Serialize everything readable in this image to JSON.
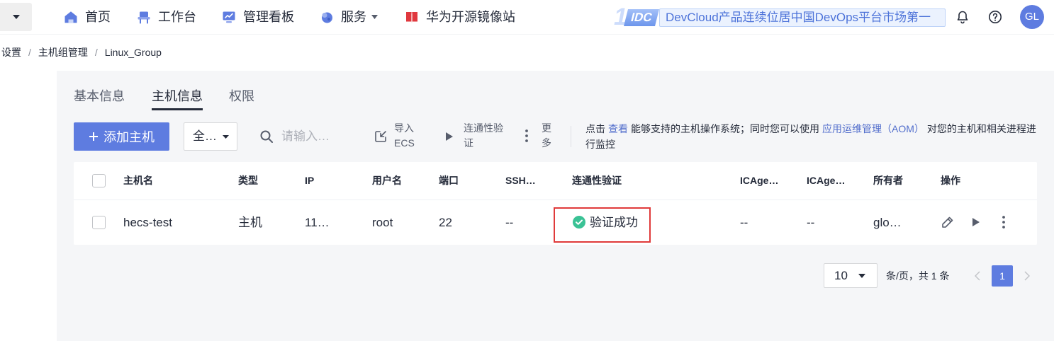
{
  "nav": {
    "items": [
      {
        "label": "首页",
        "icon": "home-icon"
      },
      {
        "label": "工作台",
        "icon": "workbench-icon"
      },
      {
        "label": "管理看板",
        "icon": "dashboard-icon"
      },
      {
        "label": "服务",
        "icon": "service-icon"
      },
      {
        "label": "华为开源镜像站",
        "icon": "mirror-site-icon"
      }
    ],
    "banner": {
      "rank": "1",
      "brand": "IDC",
      "text": "DevCloud产品连续位居中国DevOps平台市场第一"
    },
    "right_icons": [
      "bell-icon",
      "help-icon"
    ],
    "avatar_initials": "GL"
  },
  "breadcrumb": {
    "separator": "/",
    "items": [
      "设置",
      "主机组管理",
      "Linux_Group"
    ]
  },
  "tabs": [
    {
      "label": "基本信息",
      "active": false
    },
    {
      "label": "主机信息",
      "active": true
    },
    {
      "label": "权限",
      "active": false
    }
  ],
  "toolbar": {
    "add_label": "添加主机",
    "filter_value": "全…",
    "search_placeholder": "请输入…",
    "import": {
      "line1": "导入",
      "line2": "ECS",
      "icon": "import-icon"
    },
    "verify": {
      "line1": "连通性验",
      "line2": "证",
      "icon": "play-icon"
    },
    "more": {
      "line1": "更",
      "line2": "多",
      "icon": "more-vertical-icon"
    },
    "hint": {
      "prefix": "点击",
      "link_view": "查看",
      "middle": "能够支持的主机操作系统；同时您可以使用",
      "link_aom": "应用运维管理（AOM）",
      "suffix": "对您的主机和相关进程进行监控"
    }
  },
  "table": {
    "columns": [
      "主机名",
      "类型",
      "IP",
      "用户名",
      "端口",
      "SSH…",
      "连通性验证",
      "ICAge…",
      "ICAge…",
      "所有者",
      "操作"
    ],
    "rows": [
      {
        "host_name": "hecs-test",
        "type": "主机",
        "ip": "11…",
        "username": "root",
        "port": "22",
        "ssh": "--",
        "connectivity": "验证成功",
        "connectivity_icon": "check-circle-icon",
        "icagent_1": "--",
        "icagent_2": "--",
        "owner": "glo…",
        "actions": [
          "edit-icon",
          "play-icon",
          "more-vertical-icon"
        ]
      }
    ]
  },
  "pagination": {
    "page_size": "10",
    "summary": "条/页，共 1 条",
    "current_page": "1"
  },
  "colors": {
    "primary": "#5e7ce0",
    "link": "#526ecc",
    "success": "#3ac295",
    "highlight": "#e03a3a",
    "mirror_icon": "#e0383e"
  }
}
